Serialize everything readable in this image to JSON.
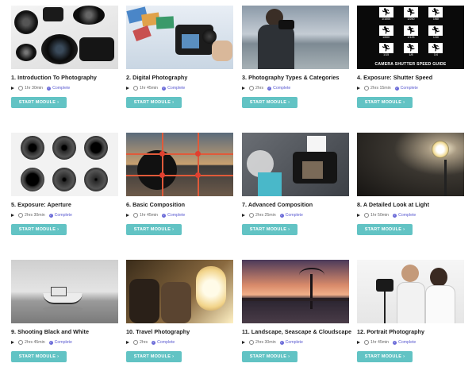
{
  "modules": [
    {
      "title": "1. Introduction To Photography",
      "duration": "1hr 30min",
      "status": "Complete",
      "button": "START MODULE",
      "thumb_icon": "camera-gear-image"
    },
    {
      "title": "2. Digital Photography",
      "duration": "1hr 45min",
      "status": "Complete",
      "button": "START MODULE",
      "thumb_icon": "digital-camera-photos-image"
    },
    {
      "title": "3. Photography Types & Categories",
      "duration": "2hrs",
      "status": "Complete",
      "button": "START MODULE",
      "thumb_icon": "photographer-beach-image"
    },
    {
      "title": "4. Exposure: Shutter Speed",
      "duration": "2hrs 15min",
      "status": "Complete",
      "button": "START MODULE",
      "thumb_icon": "shutter-speed-guide-image"
    },
    {
      "title": "5. Exposure: Aperture",
      "duration": "2hrs 30min",
      "status": "Complete",
      "button": "START MODULE",
      "thumb_icon": "aperture-lenses-image"
    },
    {
      "title": "6. Basic Composition",
      "duration": "1hr 45min",
      "status": "Complete",
      "button": "START MODULE",
      "thumb_icon": "rule-of-thirds-image"
    },
    {
      "title": "7. Advanced Composition",
      "duration": "2hrs 25min",
      "status": "Complete",
      "button": "START MODULE",
      "thumb_icon": "studio-camera-image"
    },
    {
      "title": "8. A Detailed Look at Light",
      "duration": "1hr 50min",
      "status": "Complete",
      "button": "START MODULE",
      "thumb_icon": "studio-light-image"
    },
    {
      "title": "9. Shooting Black and White",
      "duration": "2hrs 45min",
      "status": "Complete",
      "button": "START MODULE",
      "thumb_icon": "bw-boat-image"
    },
    {
      "title": "10. Travel Photography",
      "duration": "2hrs",
      "status": "Complete",
      "button": "START MODULE",
      "thumb_icon": "airplane-window-image"
    },
    {
      "title": "11. Landscape, Seascape & Cloudscape",
      "duration": "2hrs 30min",
      "status": "Complete",
      "button": "START MODULE",
      "thumb_icon": "sunset-tree-image"
    },
    {
      "title": "12. Portrait Photography",
      "duration": "1hr 45min",
      "status": "Complete",
      "button": "START MODULE",
      "thumb_icon": "portrait-couple-image"
    }
  ],
  "shutter_labels": [
    "1/1000",
    "1/250",
    "1/60",
    "1/500",
    "1/125",
    "1/30",
    "1/15",
    "1/8",
    "1/4"
  ],
  "shutter_caption": "CAMERA SHUTTER SPEED GUIDE",
  "colors": {
    "button": "#62c3c4",
    "complete": "#5a5ad0"
  }
}
